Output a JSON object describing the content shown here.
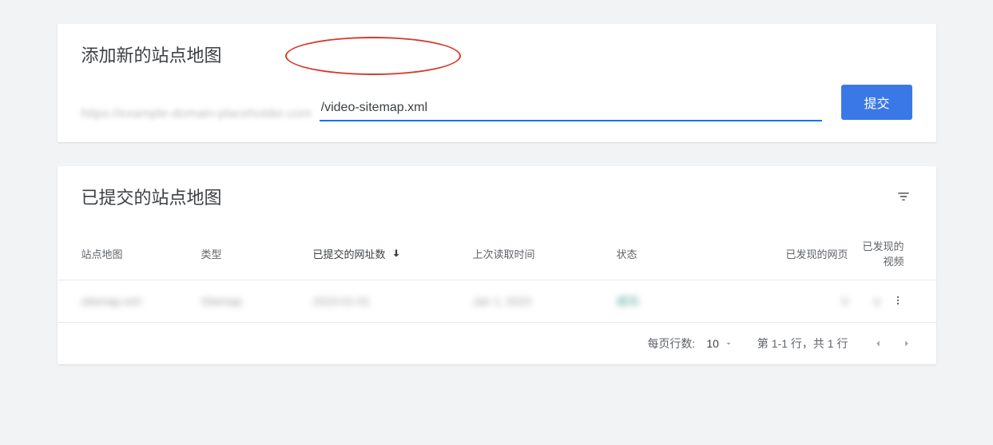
{
  "addCard": {
    "title": "添加新的站点地图",
    "urlPrefix": "https://example-domain-placeholder.com",
    "inputValue": "/video-sitemap.xml",
    "submitLabel": "提交"
  },
  "tableCard": {
    "title": "已提交的站点地图",
    "columns": {
      "sitemap": "站点地图",
      "type": "类型",
      "urlsSubmitted": "已提交的网址数",
      "lastRead": "上次读取时间",
      "status": "状态",
      "pagesDiscovered": "已发现的网页",
      "videosDiscovered": "已发现的视频"
    },
    "row": {
      "sitemap": "sitemap.xml",
      "type": "Sitemap",
      "urlsSubmitted": "2023-01-01",
      "lastRead": "Jan 1, 2023",
      "status": "成功",
      "pagesDiscovered": "0",
      "videosDiscovered": "0"
    },
    "footer": {
      "rowsPerPageLabel": "每页行数:",
      "rowsPerPageValue": "10",
      "rangeInfo": "第 1-1 行，共 1 行"
    }
  }
}
